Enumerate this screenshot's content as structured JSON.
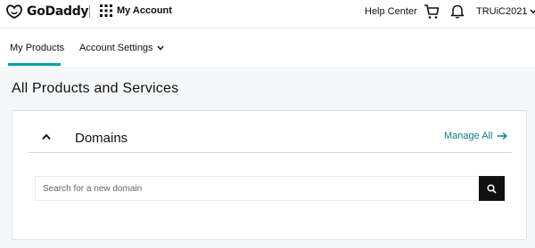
{
  "header": {
    "brand": "GoDaddy",
    "app_name": "My Account",
    "help_label": "Help Center",
    "user_name": "TRUiC2021"
  },
  "nav": {
    "tabs": [
      {
        "label": "My Products",
        "active": true
      },
      {
        "label": "Account Settings",
        "active": false
      }
    ]
  },
  "page": {
    "title": "All Products and Services"
  },
  "domains_card": {
    "title": "Domains",
    "manage_label": "Manage All",
    "search_placeholder": "Search for a new domain"
  },
  "colors": {
    "accent": "#00a4a6",
    "link": "#0b7d86",
    "search_button": "#111111"
  },
  "icons": [
    "godaddy-logo-icon",
    "apps-grid-icon",
    "cart-icon",
    "bell-icon",
    "chevron-down-icon",
    "chevron-up-icon",
    "arrow-right-icon",
    "search-icon"
  ]
}
